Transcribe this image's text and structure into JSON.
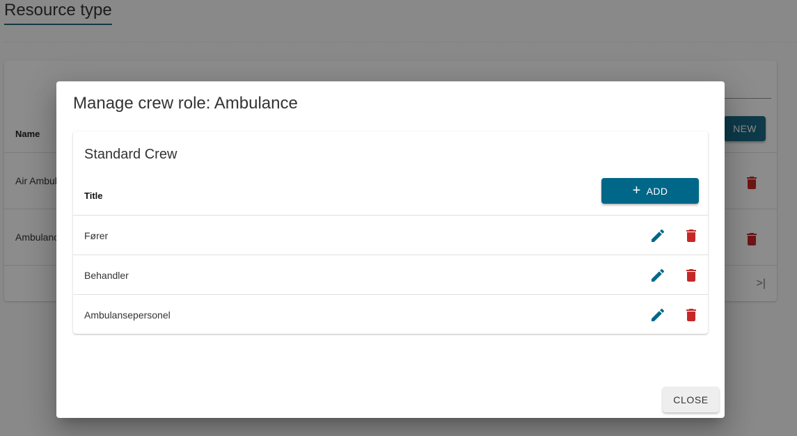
{
  "page": {
    "title": "Resource type",
    "table": {
      "column_name": "Name",
      "new_button": "NEW",
      "rows": [
        {
          "name": "Air Ambulance"
        },
        {
          "name": "Ambulance"
        }
      ],
      "pager_last": ">|"
    }
  },
  "dialog": {
    "title": "Manage crew role: Ambulance",
    "crew_card": {
      "title": "Standard Crew",
      "column_title": "Title",
      "add_button": "ADD",
      "add_icon": "+",
      "rows": [
        {
          "title": "Fører"
        },
        {
          "title": "Behandler"
        },
        {
          "title": "Ambulansepersonel"
        }
      ]
    },
    "close_button": "CLOSE"
  },
  "colors": {
    "primary": "#006788",
    "delete": "#c62828",
    "edit": "#006788"
  }
}
